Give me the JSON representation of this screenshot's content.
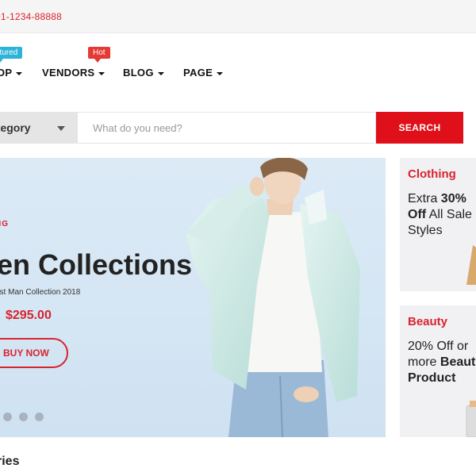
{
  "topbar": {
    "phone": "01-1234-88888"
  },
  "nav": {
    "items": [
      {
        "label": "OP"
      },
      {
        "label": "VENDORS"
      },
      {
        "label": "BLOG"
      },
      {
        "label": "PAGE"
      }
    ],
    "badges": {
      "featured": "atured",
      "hot": "Hot"
    }
  },
  "search": {
    "category_label": "ategory",
    "placeholder": "What do you need?",
    "button_label": "SEARCH"
  },
  "hero": {
    "kicker": "NG",
    "title": "en Collections",
    "subtitle": "est Man Collection 2018",
    "price": "$295.00",
    "button_label": "BUY NOW",
    "slide_count": 4,
    "active_slide": 1
  },
  "side_banners": [
    {
      "category": "Clothing",
      "line1_a": "Extra ",
      "line1_b": "30%",
      "line2_a": "Off",
      "line2_b": " All Sale",
      "line3": "Styles"
    },
    {
      "category": "Beauty",
      "line1": "20% Off or",
      "line2_a": "more ",
      "line2_b": "Beaut",
      "line3": "Product"
    }
  ],
  "section": {
    "title": "ries"
  },
  "colors": {
    "accent": "#e0101a",
    "featured_badge": "#2bb3d9",
    "hot_badge": "#e53935"
  }
}
